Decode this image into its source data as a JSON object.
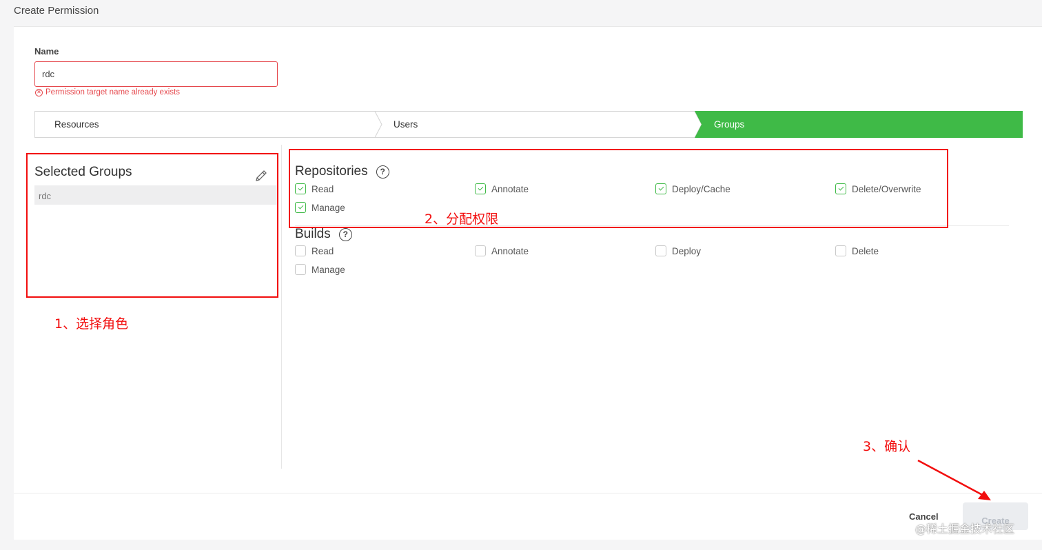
{
  "page_title": "Create Permission",
  "name_field": {
    "label": "Name",
    "value": "rdc",
    "error": "Permission target name already exists"
  },
  "wizard_steps": [
    {
      "label": "Resources",
      "active": false
    },
    {
      "label": "Users",
      "active": false
    },
    {
      "label": "Groups",
      "active": true
    }
  ],
  "selected_groups": {
    "title": "Selected Groups",
    "items": [
      "rdc"
    ]
  },
  "repositories": {
    "title": "Repositories",
    "help": "?",
    "permissions": [
      {
        "label": "Read",
        "checked": true
      },
      {
        "label": "Annotate",
        "checked": true
      },
      {
        "label": "Deploy/Cache",
        "checked": true
      },
      {
        "label": "Delete/Overwrite",
        "checked": true
      },
      {
        "label": "Manage",
        "checked": true
      }
    ]
  },
  "builds": {
    "title": "Builds",
    "help": "?",
    "permissions": [
      {
        "label": "Read",
        "checked": false
      },
      {
        "label": "Annotate",
        "checked": false
      },
      {
        "label": "Deploy",
        "checked": false
      },
      {
        "label": "Delete",
        "checked": false
      },
      {
        "label": "Manage",
        "checked": false
      }
    ]
  },
  "footer": {
    "cancel": "Cancel",
    "create": "Create"
  },
  "annotations": {
    "step1": "1、选择角色",
    "step2": "2、分配权限",
    "step3": "3、确认",
    "color": "#f20d0d"
  },
  "watermark": "@稀土掘金技术社区",
  "colors": {
    "active_step": "#3fba47",
    "error": "#e5484d"
  }
}
